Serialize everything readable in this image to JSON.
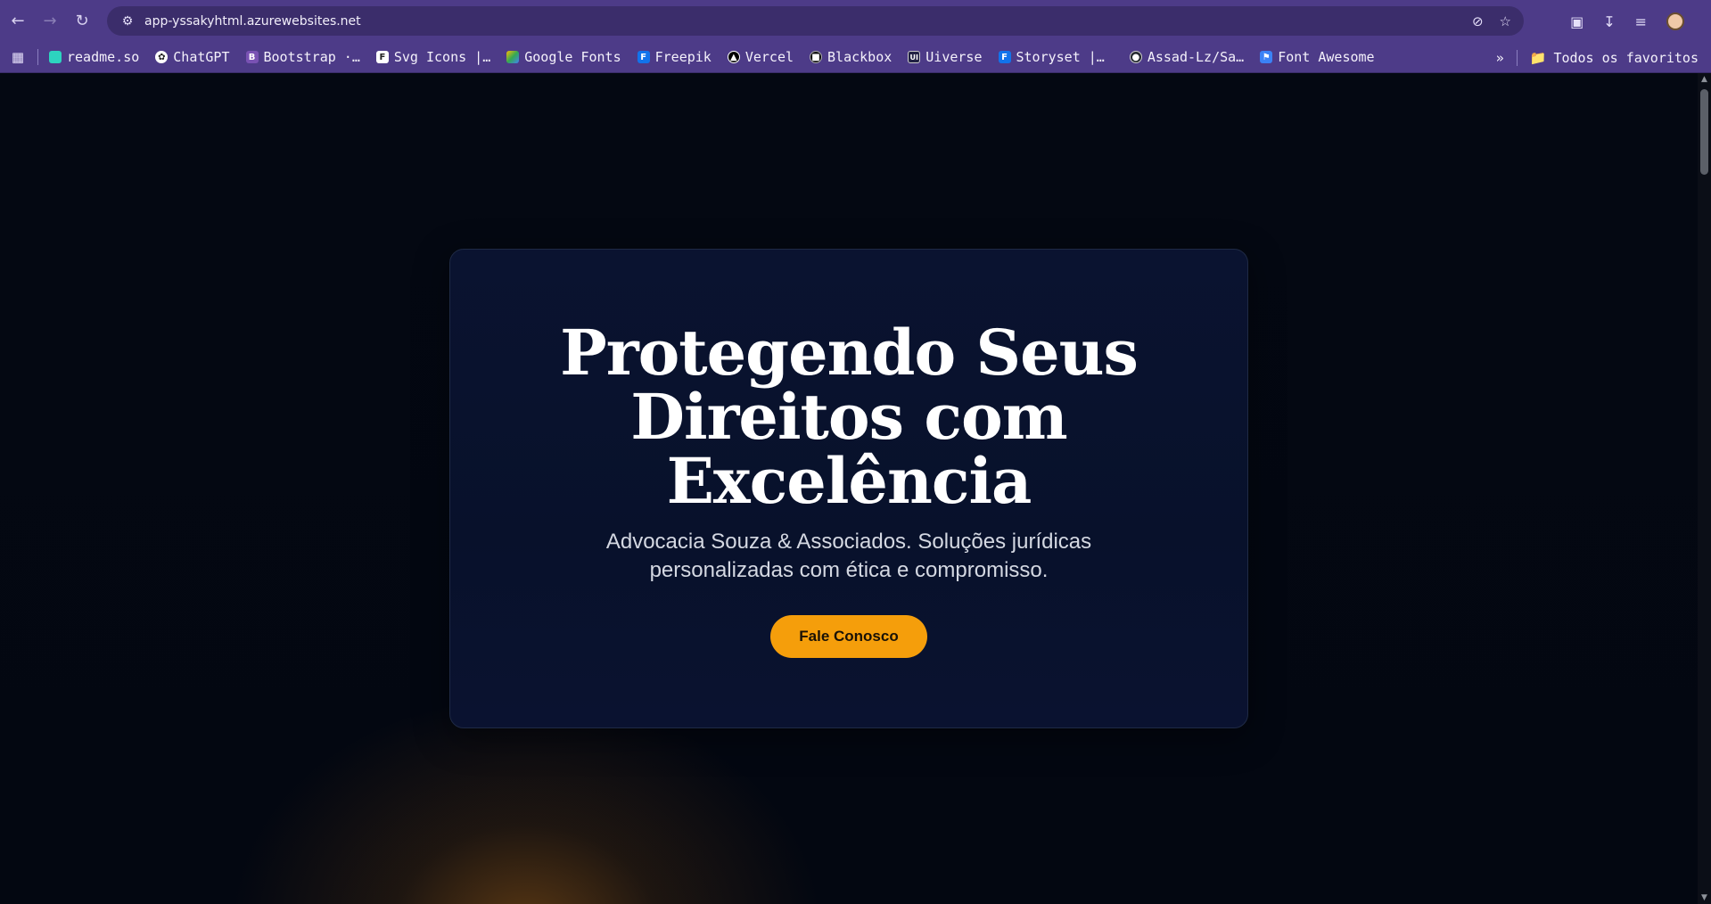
{
  "browser": {
    "url": "app-yssakyhtml.azurewebsites.net",
    "bookmarks": [
      {
        "label": "readme.so",
        "icon": "readme-icon",
        "color": "#2dd4bf"
      },
      {
        "label": "ChatGPT",
        "icon": "chatgpt-icon",
        "color": "#ffffff"
      },
      {
        "label": "Bootstrap ·…",
        "icon": "bootstrap-icon",
        "color": "#7952b3"
      },
      {
        "label": "Svg Icons |…",
        "icon": "svg-icons-icon",
        "color": "#ffffff"
      },
      {
        "label": "Google Fonts",
        "icon": "google-fonts-icon",
        "color": "#fbbc04"
      },
      {
        "label": "Freepik",
        "icon": "freepik-icon",
        "color": "#1273eb"
      },
      {
        "label": "Vercel",
        "icon": "vercel-icon",
        "color": "#000000"
      },
      {
        "label": "Blackbox",
        "icon": "blackbox-icon",
        "color": "#111111"
      },
      {
        "label": "Uiverse",
        "icon": "uiverse-icon",
        "color": "#222244"
      },
      {
        "label": "Storyset |…",
        "icon": "storyset-icon",
        "color": "#1273eb"
      },
      {
        "label": "Assad-Lz/Sa…",
        "icon": "github-icon",
        "color": "#24292f"
      },
      {
        "label": "Font Awesome",
        "icon": "font-awesome-icon",
        "color": "#3b82f6"
      }
    ],
    "all_bookmarks_label": "Todos os favoritos"
  },
  "hero": {
    "title_line1": "Protegendo Seus",
    "title_line2": "Direitos com",
    "title_line3": "Excelência",
    "subtitle": "Advocacia Souza & Associados. Soluções jurídicas personalizadas com ética e compromisso.",
    "cta_label": "Fale Conosco"
  },
  "colors": {
    "accent": "#f59e0b",
    "chrome": "#4d3b88",
    "page_bg": "#03060f"
  }
}
